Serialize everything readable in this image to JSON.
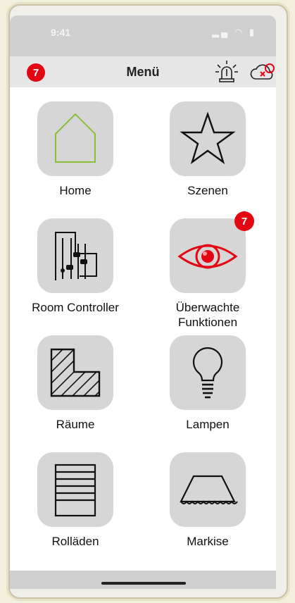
{
  "status": {
    "time": "9:41",
    "signal": "▂▄ ◠ ▮"
  },
  "nav": {
    "title": "Menü",
    "alerts_count": "7"
  },
  "tiles": [
    {
      "label": "Home",
      "icon": "house-icon"
    },
    {
      "label": "Szenen",
      "icon": "star-icon"
    },
    {
      "label": "Room Controller",
      "icon": "sliders-icon"
    },
    {
      "label": "Überwachte\nFunktionen",
      "icon": "eye-icon",
      "badge": "7"
    },
    {
      "label": "Räume",
      "icon": "room-icon"
    },
    {
      "label": "Lampen",
      "icon": "bulb-icon"
    },
    {
      "label": "Rolläden",
      "icon": "shutter-icon"
    },
    {
      "label": "Markise",
      "icon": "awning-icon"
    }
  ],
  "colors": {
    "accent": "#e30613",
    "house": "#8bbf3a",
    "tile_bg": "#d6d6d6"
  }
}
